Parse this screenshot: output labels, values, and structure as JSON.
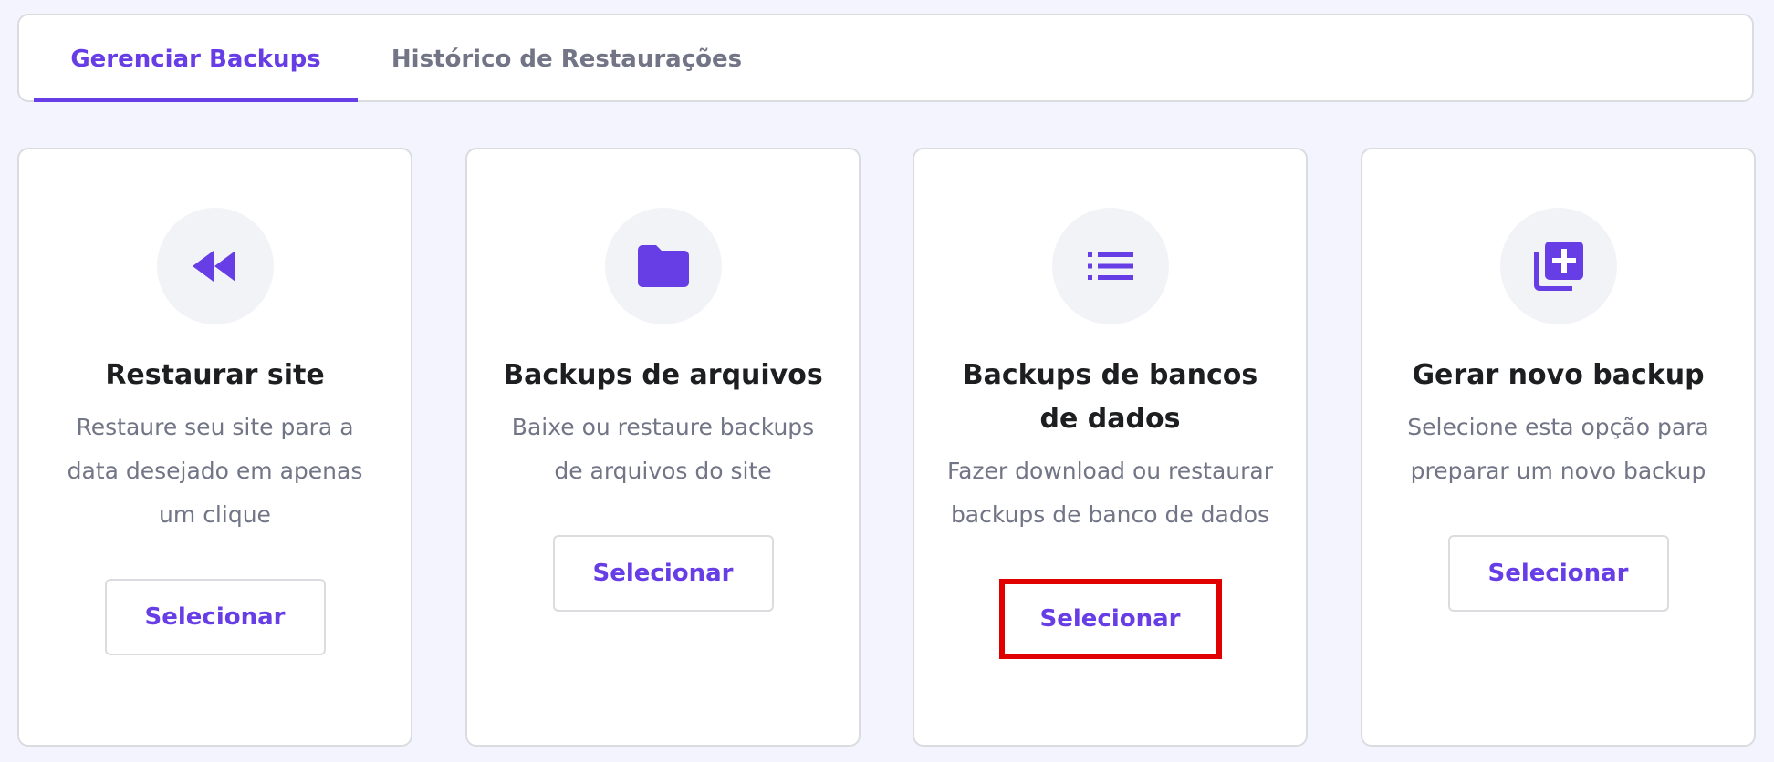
{
  "tabs": [
    {
      "label": "Gerenciar Backups",
      "active": true
    },
    {
      "label": "Histórico de Restaurações",
      "active": false
    }
  ],
  "cards": [
    {
      "icon": "rewind-icon",
      "title": "Restaurar site",
      "description": "Restaure seu site para a data desejado em apenas um clique",
      "button_label": "Selecionar"
    },
    {
      "icon": "folder-icon",
      "title": "Backups de arquivos",
      "description": "Baixe ou restaure backups de arquivos do site",
      "button_label": "Selecionar"
    },
    {
      "icon": "list-icon",
      "title": "Backups de bancos de dados",
      "description": "Fazer download ou restaurar backups de banco de dados",
      "button_label": "Selecionar",
      "highlighted": true
    },
    {
      "icon": "add-to-library-icon",
      "title": "Gerar novo backup",
      "description": "Selecione esta opção para preparar um novo backup",
      "button_label": "Selecionar"
    }
  ],
  "colors": {
    "accent": "#673de6",
    "background": "#f4f4ff",
    "muted_text": "#727586",
    "highlight_border": "#e00000"
  }
}
